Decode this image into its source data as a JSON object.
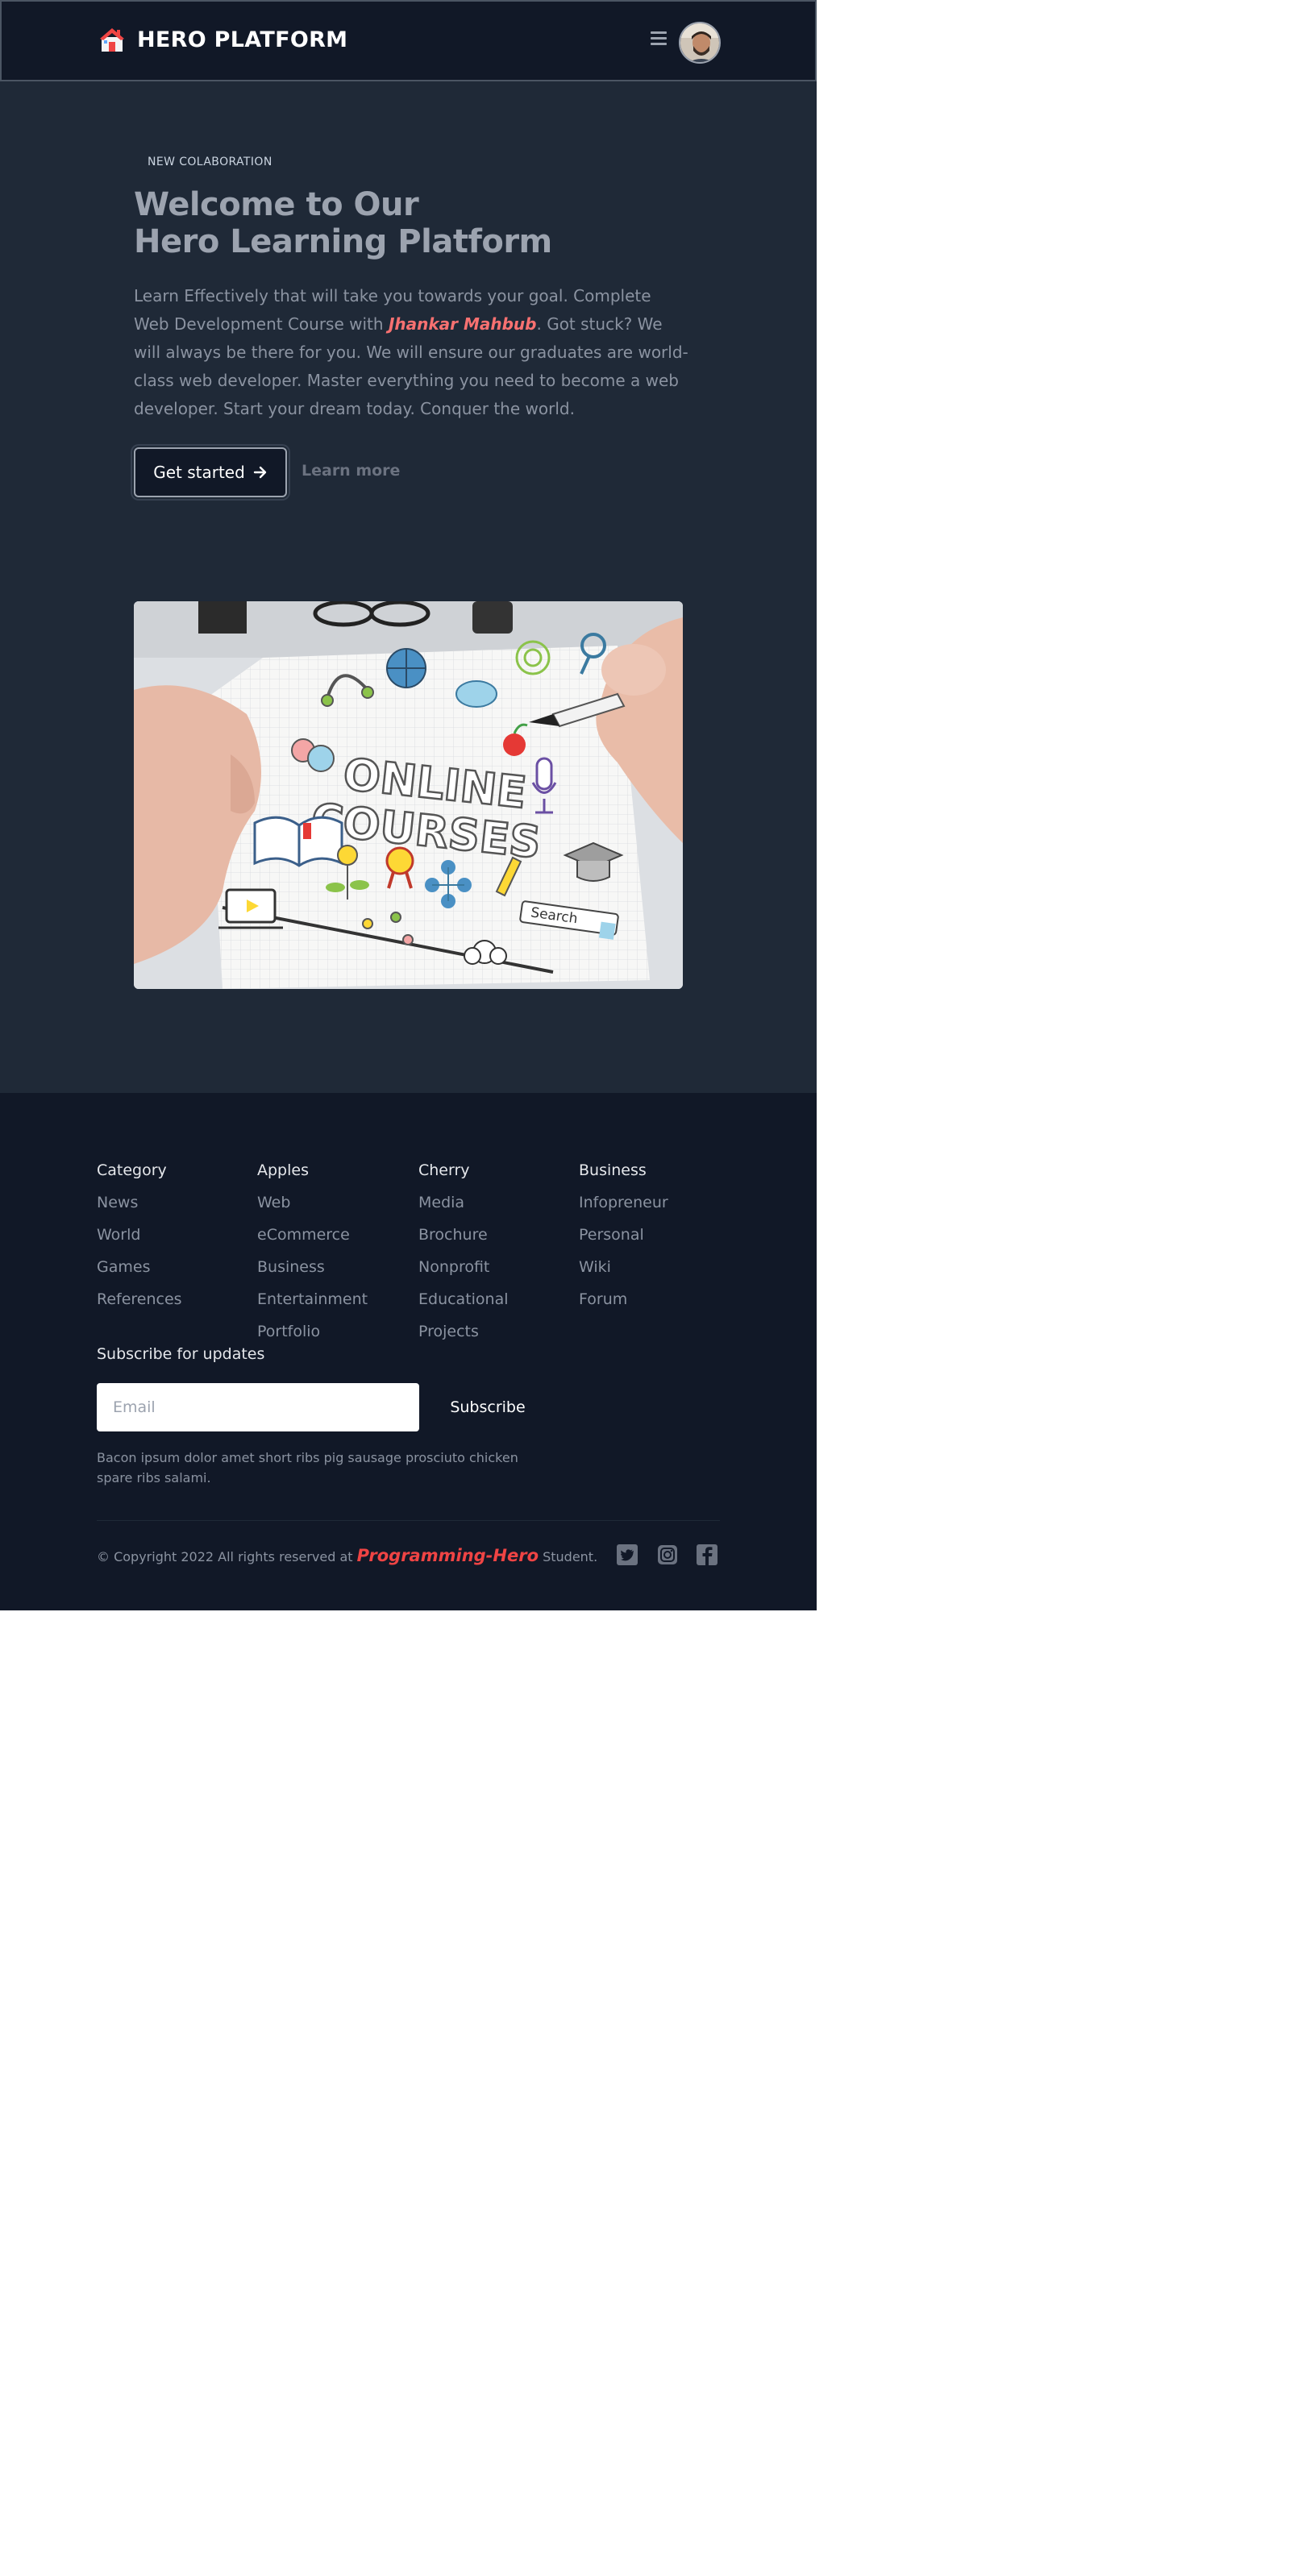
{
  "header": {
    "brand": "HERO PLATFORM",
    "logo_icon": "house-icon",
    "menu_icon": "hamburger-menu-icon",
    "avatar_icon": "user-avatar"
  },
  "hero": {
    "badge": "NEW COLABORATION",
    "title_line1": "Welcome to Our",
    "title_line2": "Hero Learning Platform",
    "desc_before": "Learn Effectively that will take you towards your goal. Complete Web Development Course with ",
    "desc_highlight": "Jhankar Mahbub",
    "desc_after": ". Got stuck? We will always be there for you. We will ensure our graduates are world-class web developer. Master everything you need to become a web developer. Start your dream today. Conquer the world.",
    "primary_button": "Get started",
    "secondary_button": "Learn more",
    "image_text_line1": "ONLINE",
    "image_text_line2": "COURSES",
    "image_search_label": "Search"
  },
  "footer": {
    "columns": [
      {
        "title": "Category",
        "links": [
          "News",
          "World",
          "Games",
          "References"
        ]
      },
      {
        "title": "Apples",
        "links": [
          "Web",
          "eCommerce",
          "Business",
          "Entertainment",
          "Portfolio"
        ]
      },
      {
        "title": "Cherry",
        "links": [
          "Media",
          "Brochure",
          "Nonprofit",
          "Educational",
          "Projects"
        ]
      },
      {
        "title": "Business",
        "links": [
          "Infopreneur",
          "Personal",
          "Wiki",
          "Forum"
        ]
      }
    ],
    "subscribe_title": "Subscribe for updates",
    "email_placeholder": "Email",
    "subscribe_button": "Subscribe",
    "note": "Bacon ipsum dolor amet short ribs pig sausage prosciuto chicken spare ribs salami.",
    "copyright_before": "© Copyright 2022 All rights reserved at ",
    "copyright_brand": "Programming-Hero",
    "copyright_after": " Student.",
    "social_icons": [
      "twitter-icon",
      "instagram-icon",
      "facebook-icon"
    ]
  },
  "colors": {
    "header_bg": "#111827",
    "hero_bg": "#1f2937",
    "accent_red": "#ef4444"
  }
}
